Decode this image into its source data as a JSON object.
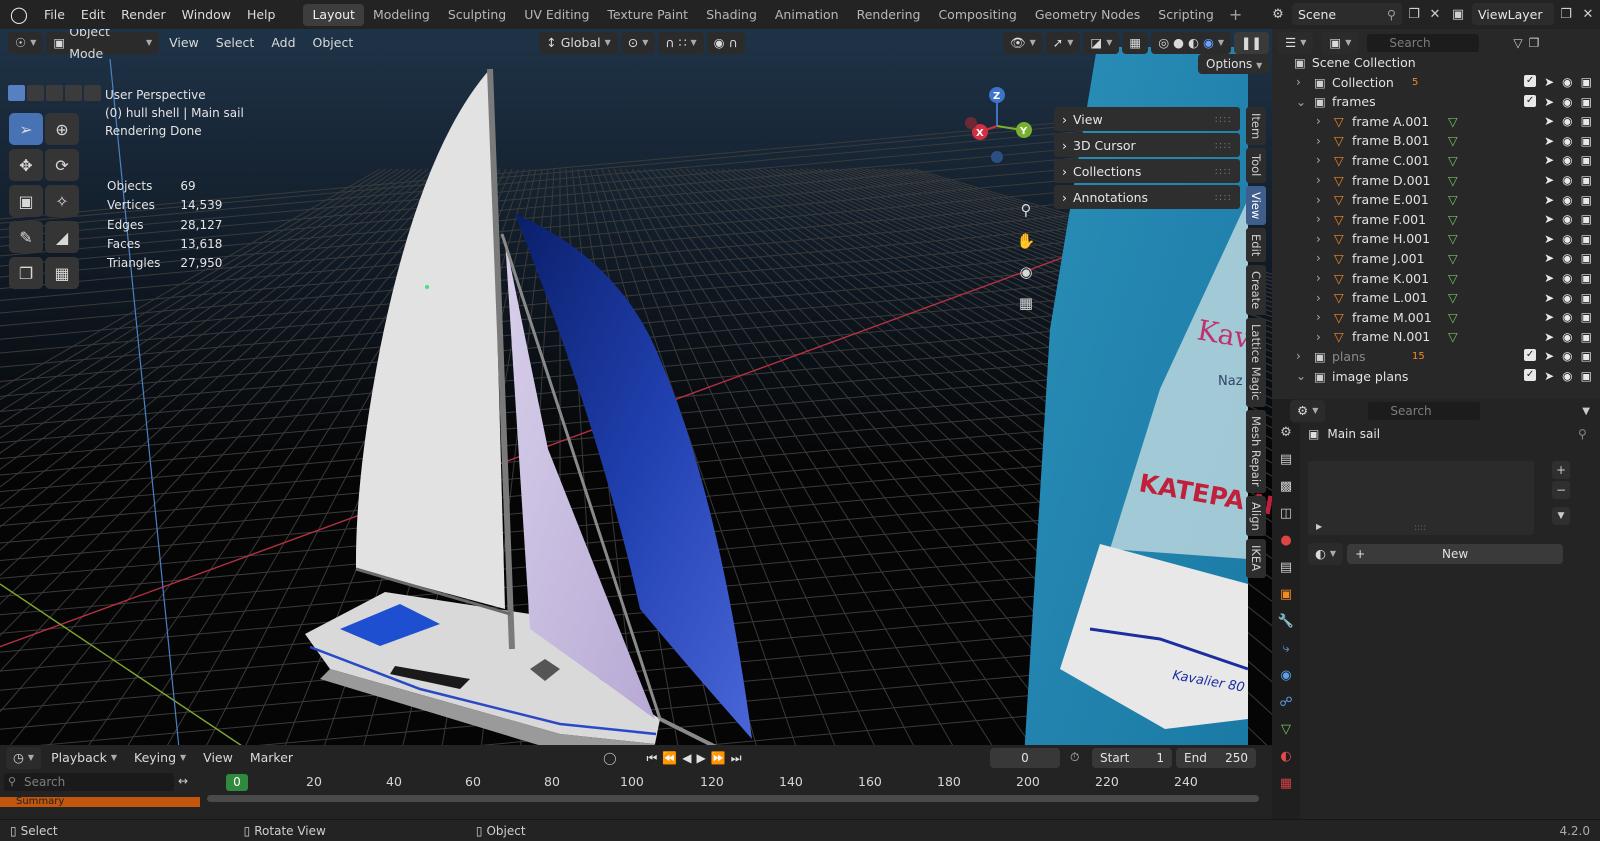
{
  "topbar": {
    "menus": [
      "File",
      "Edit",
      "Render",
      "Window",
      "Help"
    ],
    "workspaces": [
      "Layout",
      "Modeling",
      "Sculpting",
      "UV Editing",
      "Texture Paint",
      "Shading",
      "Animation",
      "Rendering",
      "Compositing",
      "Geometry Nodes",
      "Scripting"
    ],
    "active_workspace": "Layout",
    "scene": "Scene",
    "view_layer": "ViewLayer"
  },
  "viewport": {
    "mode": "Object Mode",
    "menus": [
      "View",
      "Select",
      "Add",
      "Object"
    ],
    "transform_orientation": "Global",
    "options_label": "Options",
    "overlay": {
      "line1": "User Perspective",
      "line2": "(0) hull shell | Main sail",
      "line3": "Rendering Done"
    },
    "stats": [
      {
        "label": "Objects",
        "value": "69"
      },
      {
        "label": "Vertices",
        "value": "14,539"
      },
      {
        "label": "Edges",
        "value": "28,127"
      },
      {
        "label": "Faces",
        "value": "13,618"
      },
      {
        "label": "Triangles",
        "value": "27,950"
      }
    ],
    "gizmo_axes": {
      "z": "Z",
      "x": "X",
      "y": "Y"
    },
    "npanel_sections": [
      "View",
      "3D Cursor",
      "Collections",
      "Annotations"
    ],
    "side_tabs": [
      "Item",
      "Tool",
      "View",
      "Edit",
      "Create",
      "Lattice Magic",
      "Mesh Repair",
      "Align",
      "IKEA"
    ],
    "active_side_tab": "View",
    "plan_texts": [
      "Kava",
      "Naz",
      "KATEPA N",
      "Kavalier 80"
    ]
  },
  "timeline": {
    "menus": [
      "Playback",
      "Keying",
      "View",
      "Marker"
    ],
    "current_frame": "0",
    "start_label": "Start",
    "start": "1",
    "end_label": "End",
    "end": "250",
    "ruler": [
      "0",
      "20",
      "40",
      "60",
      "80",
      "100",
      "120",
      "140",
      "160",
      "180",
      "200",
      "220",
      "240"
    ],
    "search_placeholder": "Search",
    "summary_label": "Summary"
  },
  "statusbar": {
    "select": "Select",
    "rotate": "Rotate View",
    "object": "Object",
    "version": "4.2.0"
  },
  "outliner": {
    "search_placeholder": "Search",
    "root": "Scene Collection",
    "rows": [
      {
        "name": "Collection",
        "indent": 1,
        "dim": false,
        "badge": "5"
      },
      {
        "name": "frames",
        "indent": 1,
        "dim": false,
        "badge": ""
      },
      {
        "name": "frame A.001",
        "indent": 2,
        "dim": false,
        "badge": ""
      },
      {
        "name": "frame B.001",
        "indent": 2,
        "dim": false,
        "badge": ""
      },
      {
        "name": "frame C.001",
        "indent": 2,
        "dim": false,
        "badge": ""
      },
      {
        "name": "frame D.001",
        "indent": 2,
        "dim": false,
        "badge": ""
      },
      {
        "name": "frame E.001",
        "indent": 2,
        "dim": false,
        "badge": ""
      },
      {
        "name": "frame F.001",
        "indent": 2,
        "dim": false,
        "badge": ""
      },
      {
        "name": "frame H.001",
        "indent": 2,
        "dim": false,
        "badge": ""
      },
      {
        "name": "frame J.001",
        "indent": 2,
        "dim": false,
        "badge": ""
      },
      {
        "name": "frame K.001",
        "indent": 2,
        "dim": false,
        "badge": ""
      },
      {
        "name": "frame L.001",
        "indent": 2,
        "dim": false,
        "badge": ""
      },
      {
        "name": "frame M.001",
        "indent": 2,
        "dim": false,
        "badge": ""
      },
      {
        "name": "frame N.001",
        "indent": 2,
        "dim": false,
        "badge": ""
      },
      {
        "name": "plans",
        "indent": 1,
        "dim": true,
        "badge": "15"
      },
      {
        "name": "image plans",
        "indent": 1,
        "dim": false,
        "badge": ""
      }
    ]
  },
  "properties": {
    "search_placeholder": "Search",
    "object_name": "Main sail",
    "new_button": "New"
  },
  "colors": {
    "accent": "#4772b3",
    "orange": "#f28a23",
    "green_frame": "#2f8a3e",
    "sail_blue": "#1e3aa8"
  }
}
